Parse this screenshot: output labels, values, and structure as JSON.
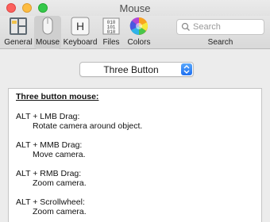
{
  "window": {
    "title": "Mouse",
    "buttons": [
      "close",
      "minimize",
      "zoom"
    ]
  },
  "toolbar": {
    "items": [
      {
        "label": "General",
        "icon": "general-icon",
        "selected": false
      },
      {
        "label": "Mouse",
        "icon": "mouse-icon",
        "selected": true
      },
      {
        "label": "Keyboard",
        "icon": "keyboard-icon",
        "selected": false
      },
      {
        "label": "Files",
        "icon": "files-icon",
        "selected": false
      },
      {
        "label": "Colors",
        "icon": "colors-icon",
        "selected": false
      }
    ],
    "search": {
      "placeholder": "Search",
      "label": "Search",
      "icon": "search-icon"
    }
  },
  "mouse_mode": {
    "selected": "Three Button"
  },
  "content": {
    "heading": "Three button mouse:",
    "entries": [
      {
        "shortcut": "ALT + LMB Drag:",
        "action": "Rotate camera around object."
      },
      {
        "shortcut": "ALT + MMB Drag:",
        "action": "Move camera."
      },
      {
        "shortcut": "ALT + RMB Drag:",
        "action": "Zoom camera."
      },
      {
        "shortcut": "ALT + Scrollwheel:",
        "action": "Zoom camera."
      }
    ]
  },
  "colors": {
    "accent": "#1e6ff0",
    "close": "#fc615d",
    "minimize": "#fdbc40",
    "zoom": "#34c84a"
  }
}
